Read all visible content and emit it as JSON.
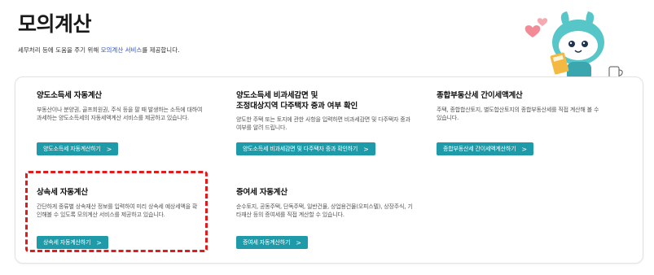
{
  "page": {
    "title": "모의계산",
    "subtitle_pre": "세무처리 등에 도움을 주기 위해 ",
    "subtitle_link": "모의계산 서비스",
    "subtitle_post": "를 제공합니다."
  },
  "cards": [
    {
      "title": "양도소득세 자동계산",
      "desc": "부동산이나 분양권, 골프회원권, 주식 등을 팔 때 발생하는 소득에 대하여 과세하는 양도소득세의 자동세액계산 서비스를 제공하고 있습니다.",
      "button": "양도소득세 자동계산하기"
    },
    {
      "title_line1": "양도소득세 비과세감면 및",
      "title_line2": "조정대상지역 다주택자 중과 여부 확인",
      "desc": "양도한 주택 또는 토지에 관한 사항을 입력하면 비과세감면 및 다주택자 중과 여부를 알려 드립니다.",
      "button": "양도소득세 비과세감면 및 다주택자 중과 확인하기"
    },
    {
      "title": "종합부동산세 간이세액계산",
      "desc": "주택, 종합합산토지, 별도합산토지의 종합부동산세를 직접 계산해 볼 수 있습니다.",
      "button": "종합부동산세 간이세액계산하기"
    },
    {
      "title": "상속세 자동계산",
      "desc": "간단하게 종류별 상속재산 정보를 입력하여 미리 상속세 예상세액을 확인해볼 수 있도록 모의계산 서비스를 제공하고 있습니다.",
      "button": "상속세 자동계산하기"
    },
    {
      "title": "증여세 자동계산",
      "desc": "순수토지, 공동주택, 단독주택, 일반건물, 상업용건물(오피스텔), 상장주식, 기타재산 등의 증여세를 직접 계산할 수 있습니다.",
      "button": "증여세 자동계산하기"
    }
  ],
  "arrow": ">",
  "colors": {
    "accent": "#1e9aa8",
    "highlight": "#e01b1b",
    "link": "#2a4fbf"
  },
  "icons": [
    "mascot-character",
    "calculator-icon",
    "heart-icon",
    "coffee-cup-icon"
  ]
}
